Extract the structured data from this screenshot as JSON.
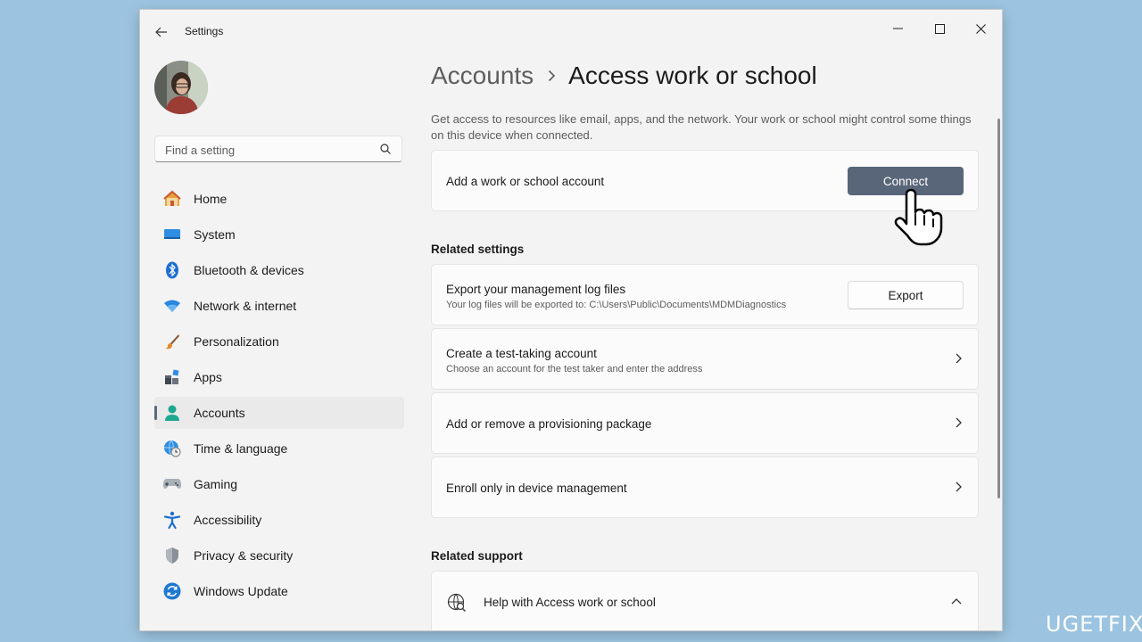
{
  "window": {
    "title": "Settings"
  },
  "search": {
    "placeholder": "Find a setting"
  },
  "sidebar": {
    "items": [
      {
        "label": "Home",
        "icon": "home-icon"
      },
      {
        "label": "System",
        "icon": "system-icon"
      },
      {
        "label": "Bluetooth & devices",
        "icon": "bluetooth-icon"
      },
      {
        "label": "Network & internet",
        "icon": "wifi-icon"
      },
      {
        "label": "Personalization",
        "icon": "brush-icon"
      },
      {
        "label": "Apps",
        "icon": "apps-icon"
      },
      {
        "label": "Accounts",
        "icon": "accounts-icon",
        "active": true
      },
      {
        "label": "Time & language",
        "icon": "globe-clock-icon"
      },
      {
        "label": "Gaming",
        "icon": "gamepad-icon"
      },
      {
        "label": "Accessibility",
        "icon": "accessibility-icon"
      },
      {
        "label": "Privacy & security",
        "icon": "shield-icon"
      },
      {
        "label": "Windows Update",
        "icon": "update-icon"
      }
    ]
  },
  "breadcrumb": {
    "parent": "Accounts",
    "current": "Access work or school"
  },
  "description": "Get access to resources like email, apps, and the network. Your work or school might control some things on this device when connected.",
  "connect_card": {
    "title": "Add a work or school account",
    "button": "Connect"
  },
  "related_settings": {
    "heading": "Related settings",
    "export": {
      "title": "Export your management log files",
      "subtitle": "Your log files will be exported to: C:\\Users\\Public\\Documents\\MDMDiagnostics",
      "button": "Export"
    },
    "test_account": {
      "title": "Create a test-taking account",
      "subtitle": "Choose an account for the test taker and enter the address"
    },
    "provisioning": {
      "title": "Add or remove a provisioning package"
    },
    "enroll": {
      "title": "Enroll only in device management"
    }
  },
  "related_support": {
    "heading": "Related support",
    "help": {
      "title": "Help with Access work or school"
    }
  },
  "watermark": {
    "text": "UG",
    "mid": "ET",
    "end": "FIX"
  },
  "colors": {
    "accent": "#59667a",
    "background": "#9cc4e0"
  }
}
